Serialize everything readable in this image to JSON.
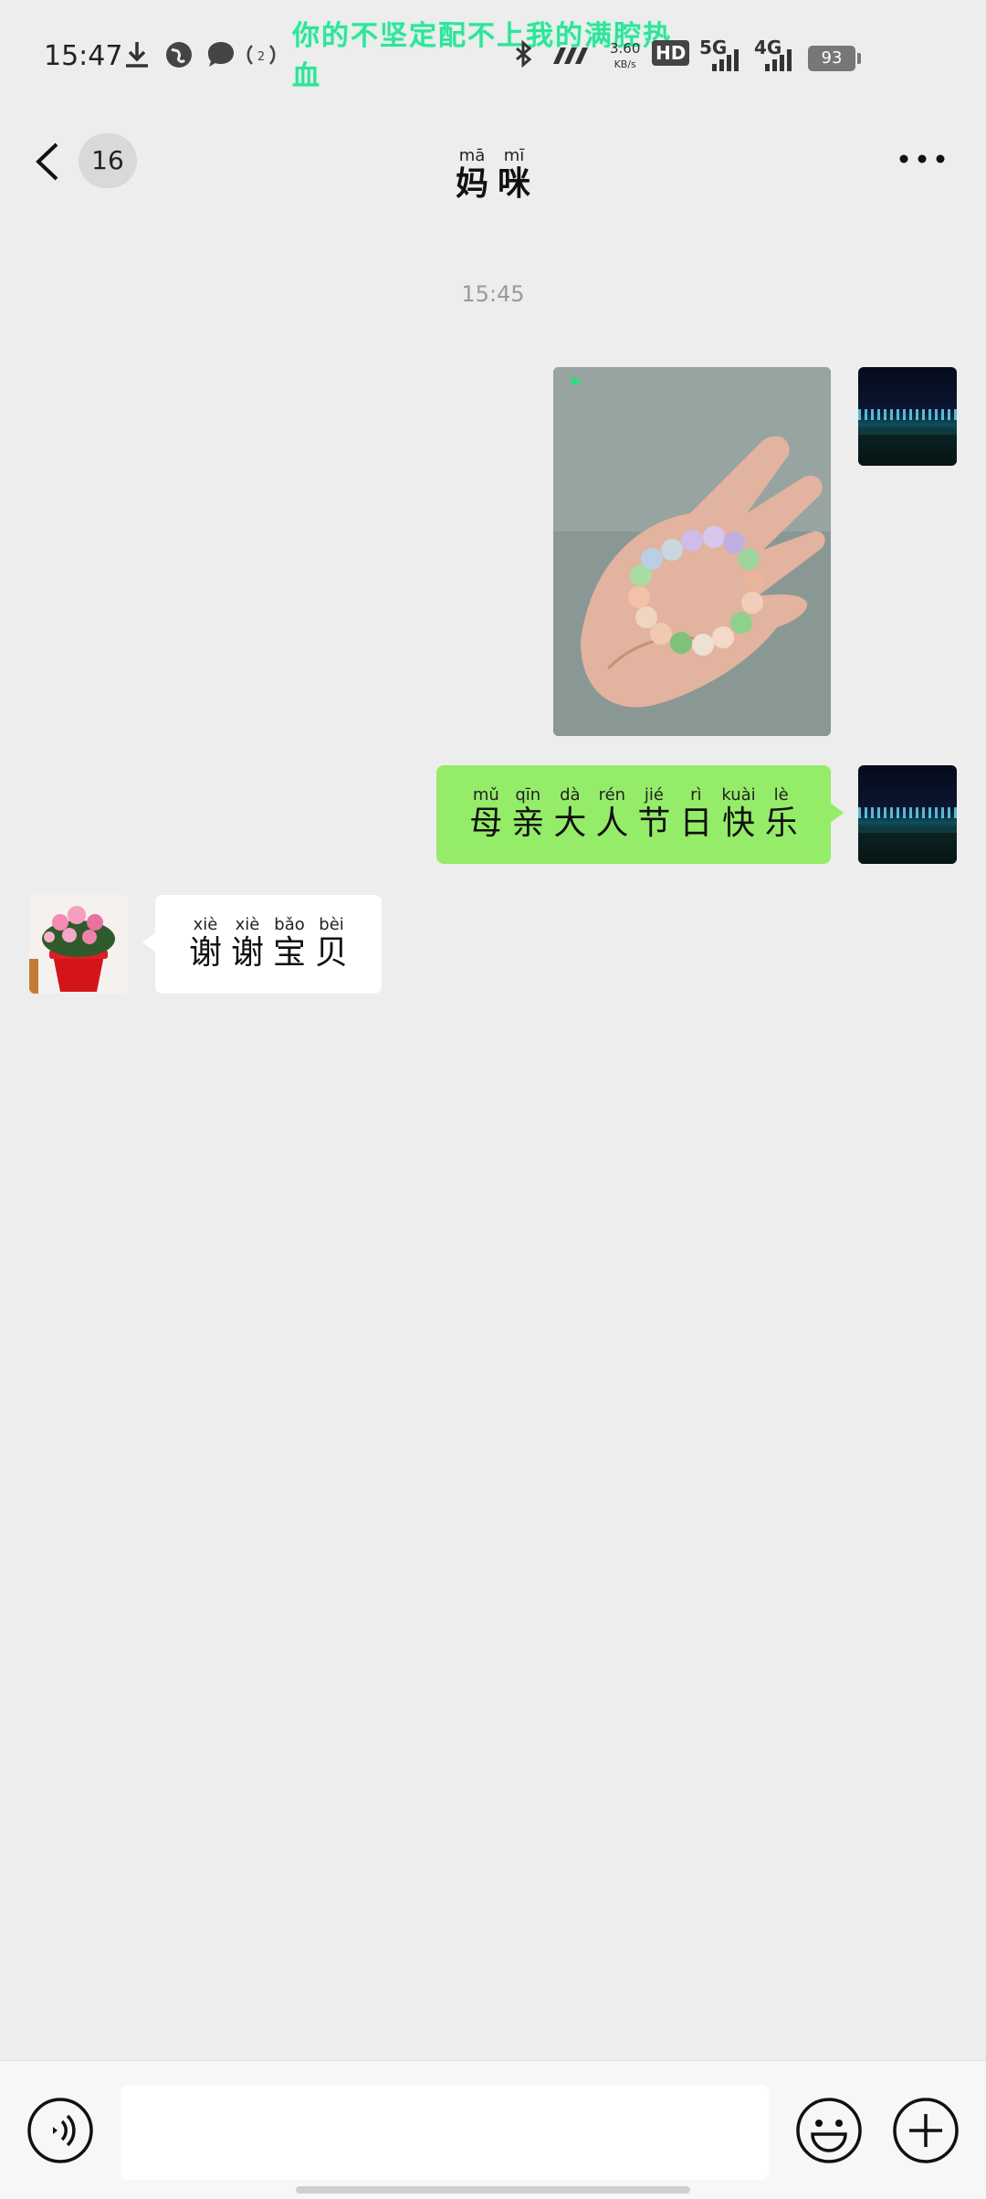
{
  "status_bar": {
    "time": "15:47",
    "banner_text": "你的不坚定配不上我的满腔热血",
    "speed_value": "3.60",
    "speed_unit": "KB/s",
    "network_5g": "5G",
    "network_4g": "4G",
    "hd_label": "HD",
    "battery": "93",
    "icons": [
      "download-icon",
      "globe-icon",
      "message-icon",
      "hotspot-icon",
      "bluetooth-icon",
      "nfc-icon",
      "signal-icon"
    ]
  },
  "nav": {
    "unread_count": "16",
    "title": [
      {
        "py": "mā",
        "hz": "妈"
      },
      {
        "py": "mī",
        "hz": "咪"
      }
    ]
  },
  "chat": {
    "timestamp": "15:45",
    "sent_text": [
      {
        "py": "mǔ",
        "hz": "母"
      },
      {
        "py": "qīn",
        "hz": "亲"
      },
      {
        "py": "dà",
        "hz": "大"
      },
      {
        "py": "rén",
        "hz": "人"
      },
      {
        "py": "jié",
        "hz": "节"
      },
      {
        "py": "rì",
        "hz": "日"
      },
      {
        "py": "kuài",
        "hz": "快"
      },
      {
        "py": "lè",
        "hz": "乐"
      }
    ],
    "received_text": [
      {
        "py": "xiè",
        "hz": "谢"
      },
      {
        "py": "xiè",
        "hz": "谢"
      },
      {
        "py": "bǎo",
        "hz": "宝"
      },
      {
        "py": "bèi",
        "hz": "贝"
      }
    ],
    "sent_bubble_color": "#95ec69",
    "received_bubble_color": "#ffffff"
  },
  "input_bar": {
    "text_value": "",
    "icons": [
      "voice-icon",
      "emoji-icon",
      "plus-icon"
    ]
  }
}
